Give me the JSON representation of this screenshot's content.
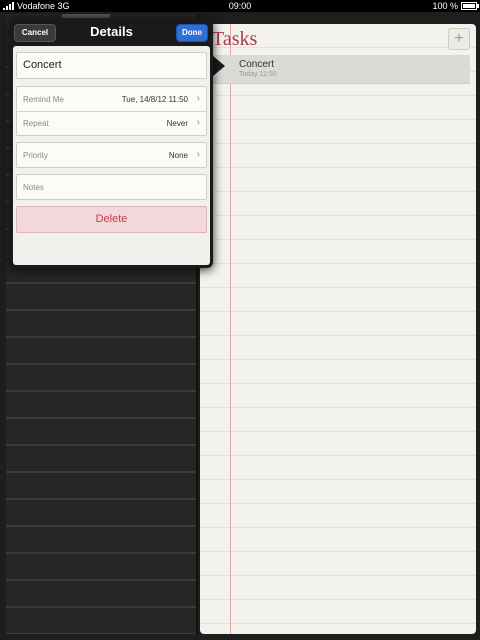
{
  "status": {
    "carrier": "Vodafone 3G",
    "time": "09:00",
    "battery": "100 %"
  },
  "tasks": {
    "title": "Tasks",
    "add_symbol": "+",
    "items": [
      {
        "name": "Concert",
        "sub": "Today 11:50"
      }
    ]
  },
  "popover": {
    "cancel": "Cancel",
    "title": "Details",
    "done": "Done",
    "task_title": "Concert",
    "remind_label": "Remind Me",
    "remind_value": "Tue, 14/8/12 11:50",
    "repeat_label": "Repeat",
    "repeat_value": "Never",
    "priority_label": "Priority",
    "priority_value": "None",
    "notes_label": "Notes",
    "delete": "Delete"
  },
  "icons": [
    "signal-icon",
    "battery-icon",
    "chevron-right-icon",
    "plus-icon"
  ]
}
